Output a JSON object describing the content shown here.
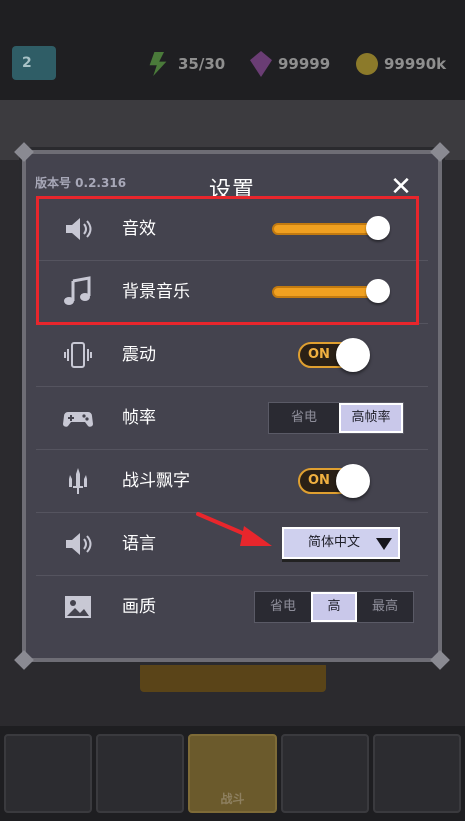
{
  "topbar": {
    "level": "2",
    "energy": "35/30",
    "gems": "99999",
    "coins": "99990k"
  },
  "bottom_nav": {
    "active_label": "战斗"
  },
  "dialog": {
    "version": "版本号 0.2.316",
    "title": "设置",
    "close_symbol": "✕",
    "rows": {
      "sound": {
        "label": "音效",
        "icon": "speaker-icon",
        "level": 0.9
      },
      "music": {
        "label": "背景音乐",
        "icon": "music-note-icon",
        "level": 0.9
      },
      "vibration": {
        "label": "震动",
        "icon": "vibration-icon",
        "toggle": "ON"
      },
      "framerate": {
        "label": "帧率",
        "icon": "gamepad-icon",
        "options": [
          "省电",
          "高帧率"
        ],
        "selected": "高帧率"
      },
      "damage_text": {
        "label": "战斗飘字",
        "icon": "swords-icon",
        "toggle": "ON"
      },
      "language": {
        "label": "语言",
        "icon": "speaker-icon",
        "value": "简体中文"
      },
      "quality": {
        "label": "画质",
        "icon": "image-icon",
        "options": [
          "省电",
          "高",
          "最高"
        ],
        "selected": "高"
      }
    }
  },
  "colors": {
    "dialog_bg": "#44434e",
    "accent_orange": "#f0a020",
    "highlight_red": "#e8262c",
    "selected_option": "#c9c8ea"
  }
}
